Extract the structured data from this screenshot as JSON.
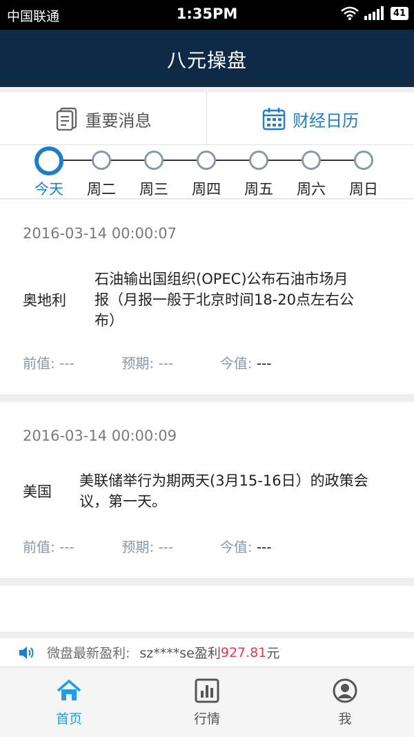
{
  "status_bar": {
    "carrier": "中国联通",
    "time": "1:35PM",
    "battery": "41"
  },
  "nav": {
    "title": "八元操盘"
  },
  "tabs": [
    {
      "label": "重要消息",
      "icon": "document-icon",
      "active": false
    },
    {
      "label": "财经日历",
      "icon": "calendar-icon",
      "active": true
    }
  ],
  "days": [
    "今天",
    "周二",
    "周三",
    "周四",
    "周五",
    "周六",
    "周日"
  ],
  "events": [
    {
      "datetime": "2016-03-14  00:00:07",
      "country": "奥地利",
      "text_lines": [
        "石油输出国组织(OPEC)公布石油市场月",
        "报（月报一般于北京时间18-20点左右公",
        "布）"
      ],
      "prev_label": "前值:",
      "prev_value": "---",
      "forecast_label": "预期:",
      "forecast_value": "---",
      "actual_label": "今值:",
      "actual_value": "---"
    },
    {
      "datetime": "2016-03-14  00:00:09",
      "country": "美国",
      "text_lines": [
        "美联储举行为期两天(3月15-16日）的政策会",
        "议，第一天。"
      ],
      "prev_label": "前值:",
      "prev_value": "---",
      "forecast_label": "预期:",
      "forecast_value": "---",
      "actual_label": "今值:",
      "actual_value": "---"
    }
  ],
  "ticker": {
    "prefix": "微盘最新盈利:",
    "user": "sz****se盈利",
    "amount": "927.81",
    "suffix": "元"
  },
  "tabbar": [
    {
      "label": "首页",
      "icon": "home-icon",
      "active": true
    },
    {
      "label": "行情",
      "icon": "chart-icon",
      "active": false
    },
    {
      "label": "我",
      "icon": "profile-icon",
      "active": false
    }
  ],
  "colors": {
    "nav_bg": "#0e2a47",
    "accent": "#1e7fc8",
    "tabbar_active": "#1e9ee6",
    "amount": "#e0394a"
  }
}
